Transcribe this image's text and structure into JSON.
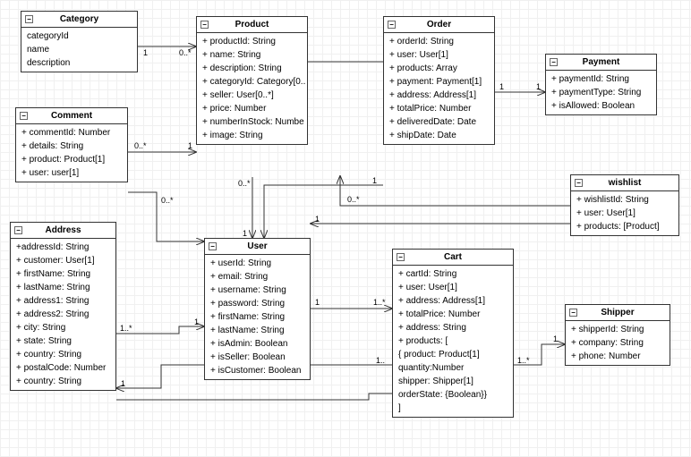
{
  "classes": {
    "category": {
      "title": "Category",
      "attrs": [
        "categoryId",
        "name",
        "description"
      ]
    },
    "product": {
      "title": "Product",
      "attrs": [
        "+ productId: String",
        "+ name: String",
        "+ description: String",
        "+ categoryId: Category[0..",
        "+ seller: User[0..*]",
        "+ price: Number",
        "+ numberInStock: Numbe",
        "+ image: String"
      ]
    },
    "order": {
      "title": "Order",
      "attrs": [
        "+ orderId: String",
        "+ user: User[1]",
        "+ products: Array",
        "+ payment: Payment[1]",
        "+ address: Address[1]",
        "+ totalPrice: Number",
        "+ deliveredDate: Date",
        "+ shipDate: Date"
      ]
    },
    "payment": {
      "title": "Payment",
      "attrs": [
        "+ paymentId: String",
        "+ paymentType: String",
        "+ isAllowed: Boolean"
      ]
    },
    "comment": {
      "title": "Comment",
      "attrs": [
        "+ commentId: Number",
        "+ details: String",
        "+ product: Product[1]",
        "+ user: user[1]"
      ]
    },
    "wishlist": {
      "title": "wishlist",
      "attrs": [
        "+ wishlistId: String",
        "+ user: User[1]",
        "+ products: [Product]"
      ]
    },
    "address": {
      "title": "Address",
      "attrs": [
        "+addressId: String",
        "+ customer: User[1]",
        "+ firstName: String",
        "+ lastName: String",
        "+ address1: String",
        "+ address2: String",
        "+ city: String",
        "+ state: String",
        "+ country: String",
        "+ postalCode: Number",
        "+ country: String"
      ]
    },
    "user": {
      "title": "User",
      "attrs": [
        "+ userId: String",
        "+ email: String",
        "+ username: String",
        "+ password: String",
        "+ firstName: String",
        "+ lastName: String",
        "+ isAdmin: Boolean",
        "+ isSeller: Boolean",
        "+ isCustomer: Boolean"
      ]
    },
    "cart": {
      "title": "Cart",
      "attrs": [
        "+ cartId: String",
        "+ user: User[1]",
        "+ address: Address[1]",
        "+ totalPrice: Number",
        "+ address: String",
        "+ products: [",
        "{   product: Product[1]",
        "    quantity:Number",
        "    shipper: Shipper[1]",
        "    orderState: {Boolean}}",
        "]"
      ]
    },
    "shipper": {
      "title": "Shipper",
      "attrs": [
        "+ shipperId: String",
        "+ company: String",
        "+ phone: Number"
      ]
    }
  },
  "mult": {
    "m1": "1",
    "m2": "0..*",
    "m3": "0..*",
    "m4": "1",
    "m5": "0..*",
    "m6": "1",
    "m7": "1",
    "m8": "1",
    "m9": "0..*",
    "m10": "1",
    "m11": "1..*",
    "m12": "1",
    "m13": "1",
    "m14": "1..*",
    "m15": "1",
    "m16": "1..",
    "m17": "0..*",
    "m18": "1",
    "m19": "1",
    "m20": "1..*"
  }
}
